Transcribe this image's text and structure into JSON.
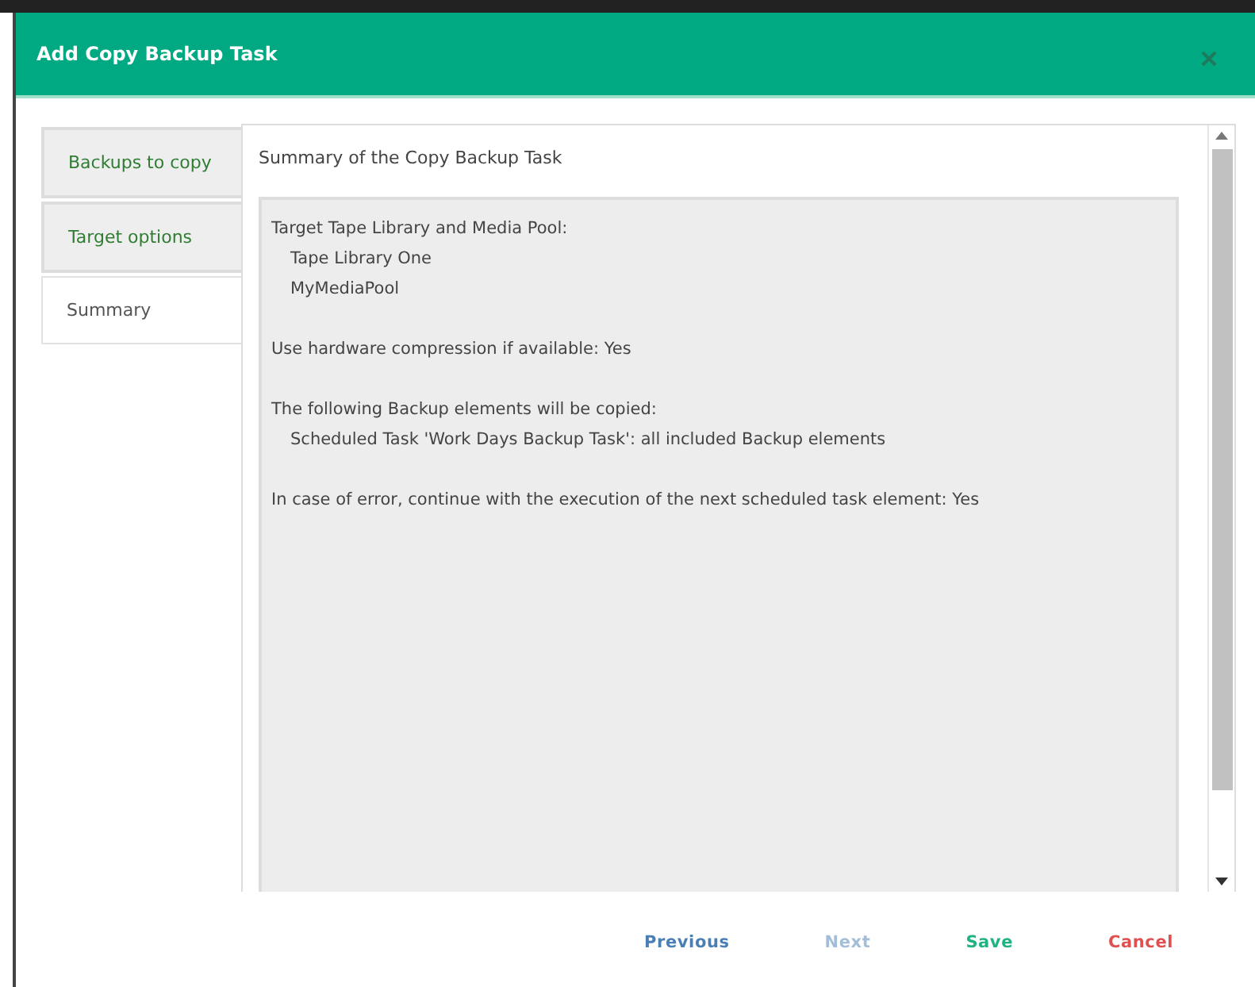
{
  "dialog": {
    "title": "Add Copy Backup Task"
  },
  "tabs": [
    {
      "label": "Backups to copy",
      "selected": false
    },
    {
      "label": "Target options",
      "selected": false
    },
    {
      "label": "Summary",
      "selected": true
    }
  ],
  "summary": {
    "title": "Summary of the Copy Backup Task",
    "sections": [
      {
        "heading": "Target Tape Library and Media Pool:",
        "items": [
          "Tape Library One",
          "MyMediaPool"
        ]
      },
      {
        "heading": "Use hardware compression if available: Yes"
      },
      {
        "heading": "The following Backup elements will be copied:",
        "items": [
          "Scheduled Task 'Work Days Backup Task': all included Backup elements"
        ]
      },
      {
        "heading": "In case of error, continue with the execution of the next scheduled task element: Yes"
      }
    ]
  },
  "buttons": [
    {
      "label": "Previous",
      "kind": "nav",
      "disabled": false
    },
    {
      "label": "Next",
      "kind": "nav",
      "disabled": true
    },
    {
      "label": "Save",
      "kind": "save",
      "disabled": false
    },
    {
      "label": "Cancel",
      "kind": "cancel",
      "disabled": false
    }
  ]
}
